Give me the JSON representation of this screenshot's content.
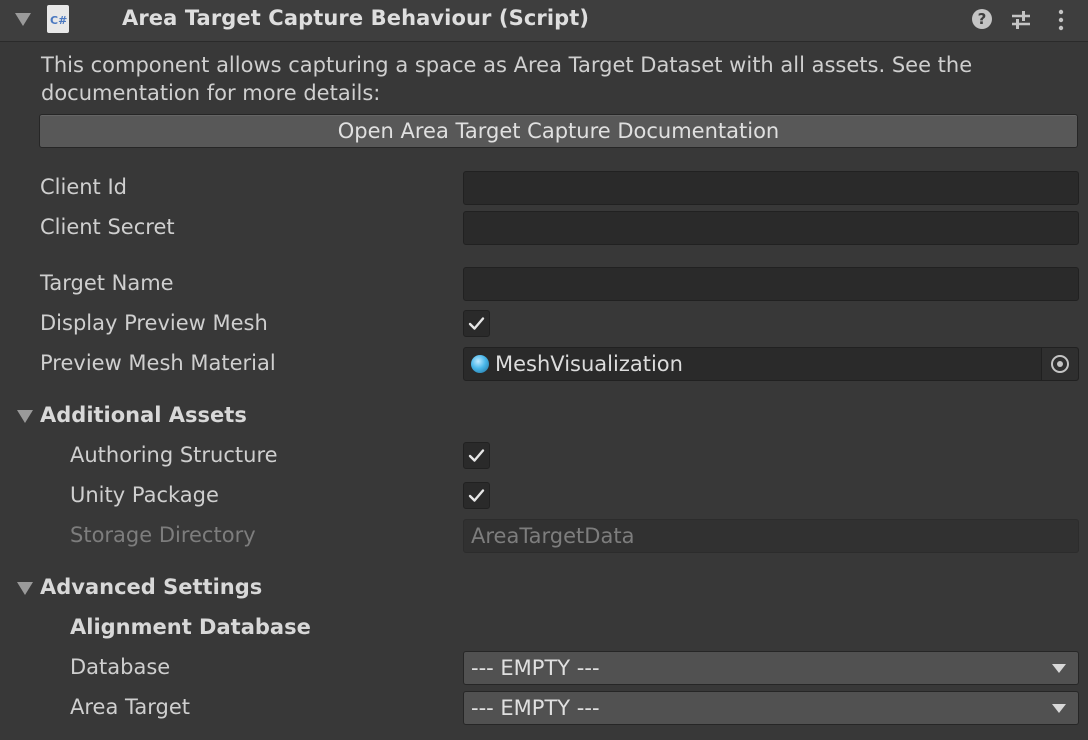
{
  "header": {
    "title": "Area Target Capture Behaviour (Script)",
    "script_icon_text": "C#",
    "help_glyph": "?",
    "icons": [
      "help-icon",
      "preset-sliders-icon",
      "more-vert-icon"
    ]
  },
  "description": "This component allows capturing a space as Area Target Dataset with all assets. See the documentation for more details:",
  "doc_button_label": "Open Area Target Capture Documentation",
  "fields": {
    "client_id": {
      "label": "Client Id",
      "value": ""
    },
    "client_secret": {
      "label": "Client Secret",
      "value": ""
    },
    "target_name": {
      "label": "Target Name",
      "value": ""
    },
    "display_preview_mesh": {
      "label": "Display Preview Mesh",
      "checked": true
    },
    "preview_mesh_material": {
      "label": "Preview Mesh Material",
      "value": "MeshVisualization"
    }
  },
  "additional_assets": {
    "title": "Additional Assets",
    "authoring_structure": {
      "label": "Authoring Structure",
      "checked": true
    },
    "unity_package": {
      "label": "Unity Package",
      "checked": true
    },
    "storage_directory": {
      "label": "Storage Directory",
      "value": "AreaTargetData"
    }
  },
  "advanced_settings": {
    "title": "Advanced Settings",
    "alignment_title": "Alignment Database",
    "database": {
      "label": "Database",
      "value": "--- EMPTY ---"
    },
    "area_target": {
      "label": "Area Target",
      "value": "--- EMPTY ---"
    }
  },
  "colors": {
    "background": "#383838",
    "header": "#3e3e3e",
    "field": "#2a2a2a",
    "button": "#585858",
    "material_accent": "#49b7ea"
  }
}
